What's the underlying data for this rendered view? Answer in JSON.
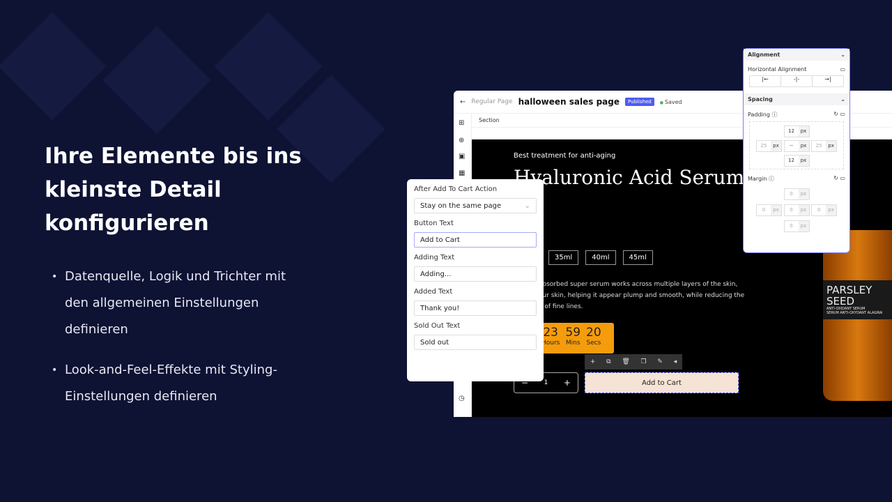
{
  "hero": {
    "heading": "Ihre Elemente bis ins kleinste Detail konfigurieren",
    "bullets": [
      "Datenquelle, Logik und Trichter mit den allgemeinen Einstellungen definieren",
      "Look-and-Feel-Effekte mit Styling-Einstellungen definieren"
    ]
  },
  "editor": {
    "back_label": "Regular Page",
    "page_title": "halloween sales page",
    "status_badge": "Published",
    "save_status": "Saved",
    "breadcrumb": "Section"
  },
  "product": {
    "subtitle": "Best treatment for anti-aging",
    "title": "Hyaluronic Acid Serum",
    "sizes": [
      "35ml",
      "40ml",
      "45ml"
    ],
    "description": [
      "absorbed super serum works across multiple layers of the skin,",
      "our skin, helping it appear plump and smooth, while reducing the",
      "e of fine lines."
    ],
    "countdown": [
      {
        "value": "23",
        "unit": "Hours"
      },
      {
        "value": "59",
        "unit": "Mins"
      },
      {
        "value": "20",
        "unit": "Secs"
      }
    ],
    "quantity": "1",
    "add_to_cart": "Add to Cart",
    "bottle_label": "PARSLEY SEED",
    "bottle_sub": [
      "ANTI-OXIDANT SERUM",
      "SERUM ANTI-OXYDANT ALAGRAI"
    ]
  },
  "cart_settings": {
    "after_action_label": "After Add To Cart Action",
    "after_action_value": "Stay on the same page",
    "button_text_label": "Button Text",
    "button_text_value": "Add to Cart",
    "adding_label": "Adding Text",
    "adding_value": "Adding...",
    "added_label": "Added Text",
    "added_value": "Thank you!",
    "sold_out_label": "Sold Out Text",
    "sold_out_value": "Sold out"
  },
  "style_panel": {
    "alignment": "Alignment",
    "horizontal_alignment": "Horizontal Alignment",
    "spacing": "Spacing",
    "padding": "Padding",
    "padding_values": {
      "top": "12",
      "left": "25",
      "center": "--",
      "right": "25",
      "bottom": "12"
    },
    "margin": "Margin",
    "margin_values": {
      "top": "0",
      "left": "0",
      "center": "0",
      "right": "0",
      "bottom": "0"
    },
    "unit": "px"
  },
  "colors": {
    "background": "#0e1233",
    "accent": "#4f5bf0",
    "countdown": "#f59c0c",
    "cart_button": "#f5e3d6"
  }
}
